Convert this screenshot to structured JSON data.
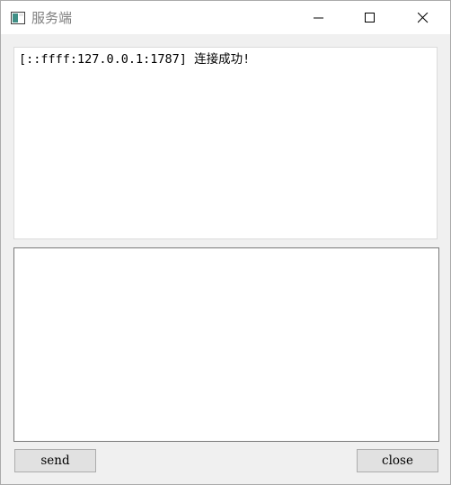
{
  "window": {
    "title": "服务端"
  },
  "log": {
    "text": "[::ffff:127.0.0.1:1787] 连接成功!"
  },
  "input": {
    "value": "",
    "placeholder": ""
  },
  "buttons": {
    "send_label": "send",
    "close_label": "close"
  },
  "colors": {
    "title_text": "#7f7f7f",
    "button_face": "#e1e1e1",
    "button_border": "#adadad"
  }
}
